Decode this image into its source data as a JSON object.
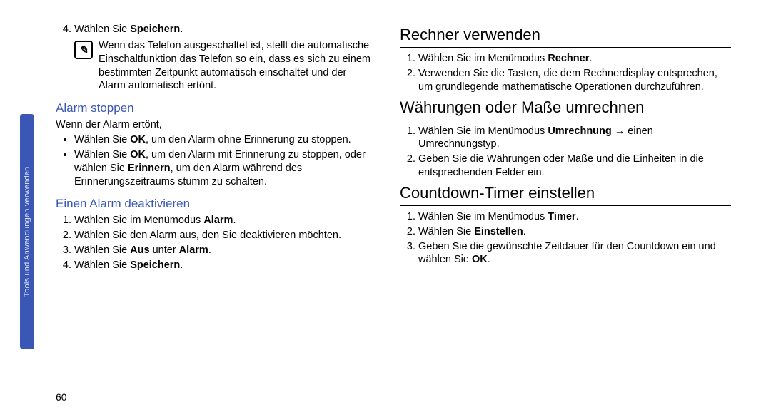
{
  "sidebar": {
    "tab_label": "Tools und Anwendungen verwenden"
  },
  "page_number": "60",
  "left_column": {
    "step4": {
      "num": "4.",
      "prefix": "Wählen Sie ",
      "bold": "Speichern",
      "suffix": "."
    },
    "note_icon": "✎",
    "note": "Wenn das Telefon ausgeschaltet ist, stellt die automatische Einschaltfunktion das Telefon so ein, dass es sich zu einem bestimmten Zeitpunkt automatisch einschaltet und der Alarm automatisch ertönt.",
    "h2_alarm_stoppen": "Alarm stoppen",
    "alarm_intro": "Wenn der Alarm ertönt,",
    "alarm_bullet1_pre": "Wählen Sie ",
    "alarm_bullet1_b": "OK",
    "alarm_bullet1_post": ", um den Alarm ohne Erinnerung zu stoppen.",
    "alarm_bullet2_pre": "Wählen Sie ",
    "alarm_bullet2_b1": "OK",
    "alarm_bullet2_mid": ", um den Alarm mit Erinnerung zu stoppen, oder wählen Sie ",
    "alarm_bullet2_b2": "Erinnern",
    "alarm_bullet2_post": ", um den Alarm während des Erinnerungszeitraums stumm zu schalten.",
    "h2_alarm_deakt": "Einen Alarm deaktivieren",
    "deakt_1_pre": "Wählen Sie im Menümodus ",
    "deakt_1_b": "Alarm",
    "deakt_1_post": ".",
    "deakt_2": "Wählen Sie den Alarm aus, den Sie deaktivieren möchten.",
    "deakt_3_pre": "Wählen Sie ",
    "deakt_3_b1": "Aus",
    "deakt_3_mid": " unter ",
    "deakt_3_b2": "Alarm",
    "deakt_3_post": ".",
    "deakt_4_pre": "Wählen Sie ",
    "deakt_4_b": "Speichern",
    "deakt_4_post": "."
  },
  "right_column": {
    "h1_rechner": "Rechner verwenden",
    "rech_1_pre": "Wählen Sie im Menümodus ",
    "rech_1_b": "Rechner",
    "rech_1_post": ".",
    "rech_2": "Verwenden Sie die Tasten, die dem Rechnerdisplay entsprechen, um grundlegende mathematische Operationen durchzuführen.",
    "h1_umrechnen": "Währungen oder Maße umrechnen",
    "umr_1_pre": "Wählen Sie im Menümodus ",
    "umr_1_b": "Umrechnung",
    "umr_1_post": " → einen Umrechnungstyp.",
    "umr_2": "Geben Sie die Währungen oder Maße und die Einheiten in die entsprechenden Felder ein.",
    "h1_timer": "Countdown-Timer einstellen",
    "tim_1_pre": "Wählen Sie im Menümodus ",
    "tim_1_b": "Timer",
    "tim_1_post": ".",
    "tim_2_pre": "Wählen Sie ",
    "tim_2_b": "Einstellen",
    "tim_2_post": ".",
    "tim_3_pre": "Geben Sie die gewünschte Zeitdauer für den Countdown ein und wählen Sie ",
    "tim_3_b": "OK",
    "tim_3_post": "."
  }
}
